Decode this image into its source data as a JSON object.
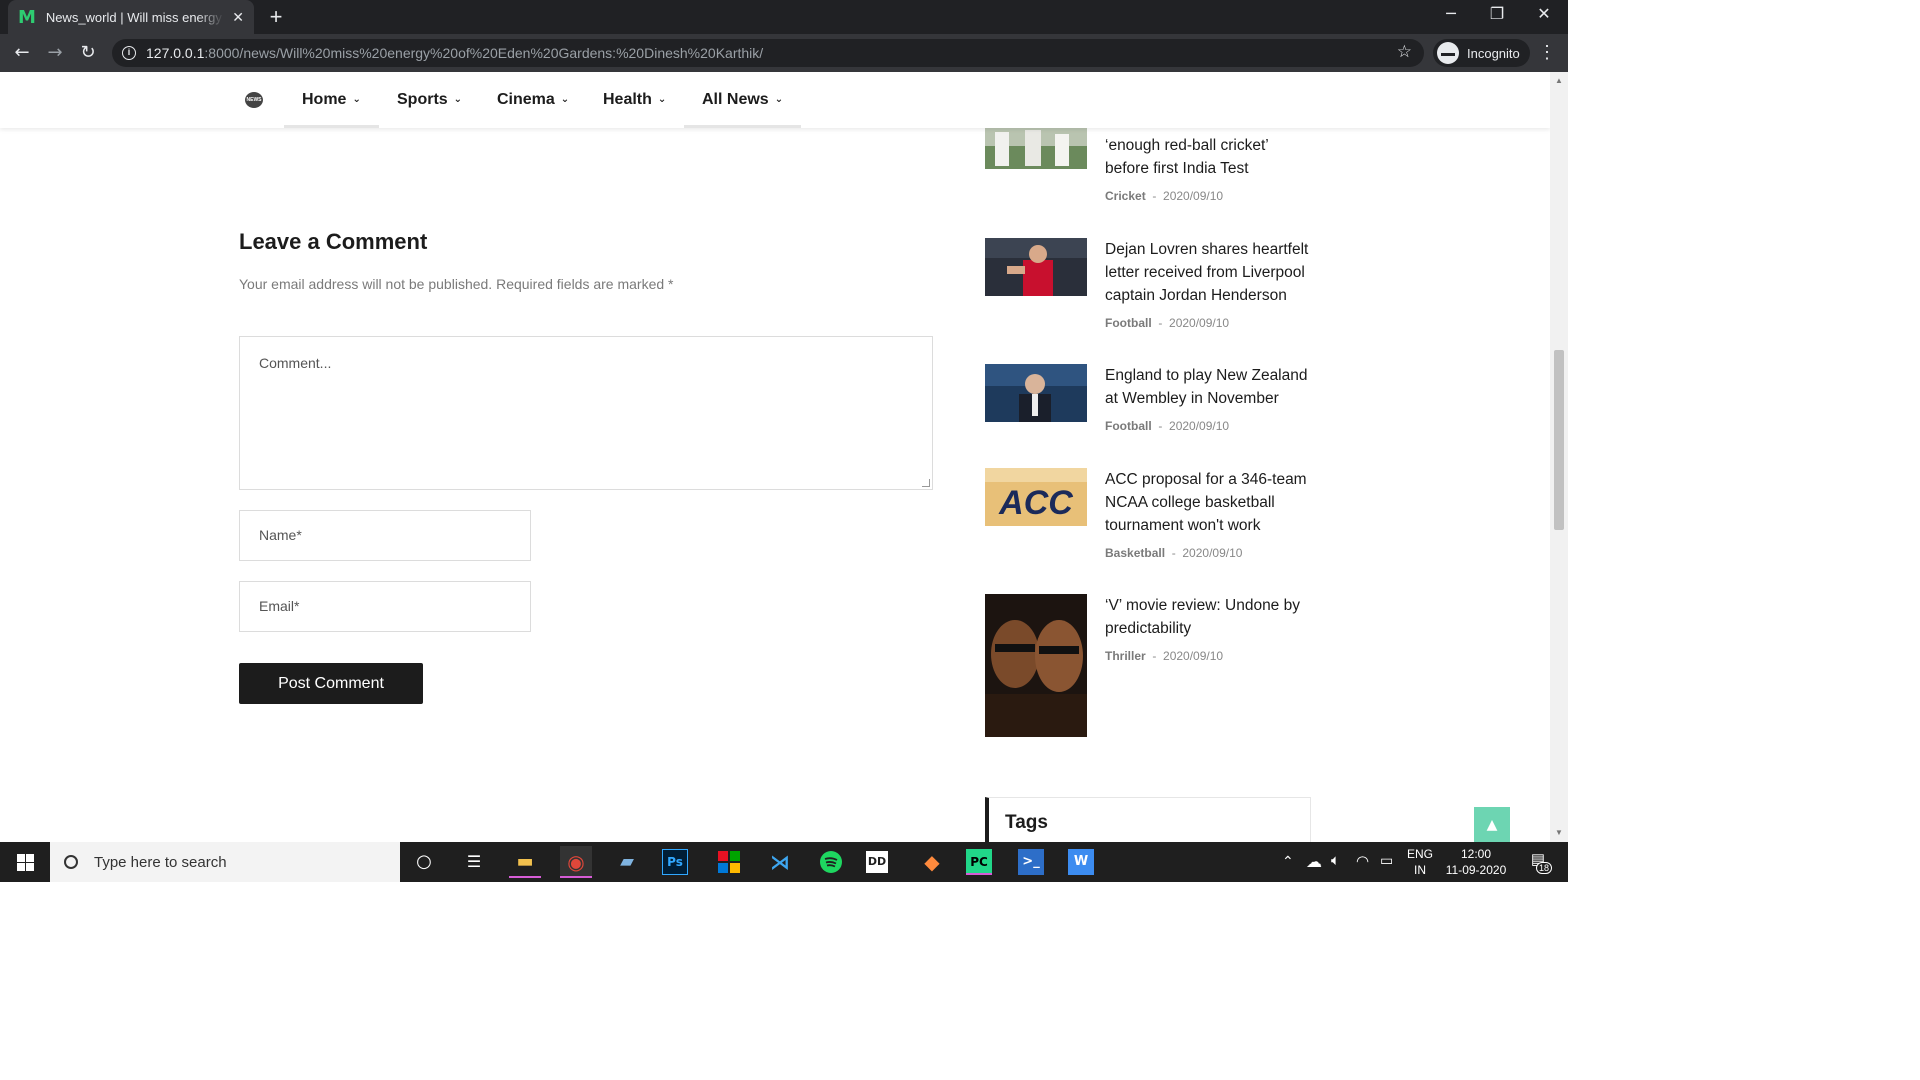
{
  "browser": {
    "tab_favicon": "M",
    "tab_title": "News_world | Will miss energy of Eden Gardens: Dinesh Karthik",
    "tab_close": "✕",
    "new_tab": "+",
    "url_host": "127.0.0.1",
    "url_rest": ":8000/news/Will%20miss%20energy%20of%20Eden%20Gardens:%20Dinesh%20Karthik/",
    "profile_label": "Incognito"
  },
  "nav": {
    "items": [
      {
        "label": "Home"
      },
      {
        "label": "Sports"
      },
      {
        "label": "Cinema"
      },
      {
        "label": "Health"
      },
      {
        "label": "All News"
      }
    ]
  },
  "comment_form": {
    "title": "Leave a Comment",
    "note": "Your email address will not be published. Required fields are marked *",
    "comment_placeholder": "Comment...",
    "name_placeholder": "Name*",
    "email_placeholder": "Email*",
    "submit_label": "Post Comment"
  },
  "sidebar": {
    "news": [
      {
        "title": "‘enough red-ball cricket’ before first India Test",
        "category": "Cricket",
        "date": "2020/09/10"
      },
      {
        "title": "Dejan Lovren shares heartfelt letter received from Liverpool captain Jordan Henderson",
        "category": "Football",
        "date": "2020/09/10"
      },
      {
        "title": "England to play New Zealand at Wembley in November",
        "category": "Football",
        "date": "2020/09/10"
      },
      {
        "title": "ACC proposal for a 346-team NCAA college basketball tournament won't work",
        "category": "Basketball",
        "date": "2020/09/10"
      },
      {
        "title": "‘V’ movie review: Undone by predictability",
        "category": "Thriller",
        "date": "2020/09/10"
      }
    ],
    "tags_title": "Tags"
  },
  "taskbar": {
    "search_placeholder": "Type here to search",
    "lang_line1": "ENG",
    "lang_line2": "IN",
    "time": "12:00",
    "date": "11-09-2020",
    "notification_count": "18"
  }
}
